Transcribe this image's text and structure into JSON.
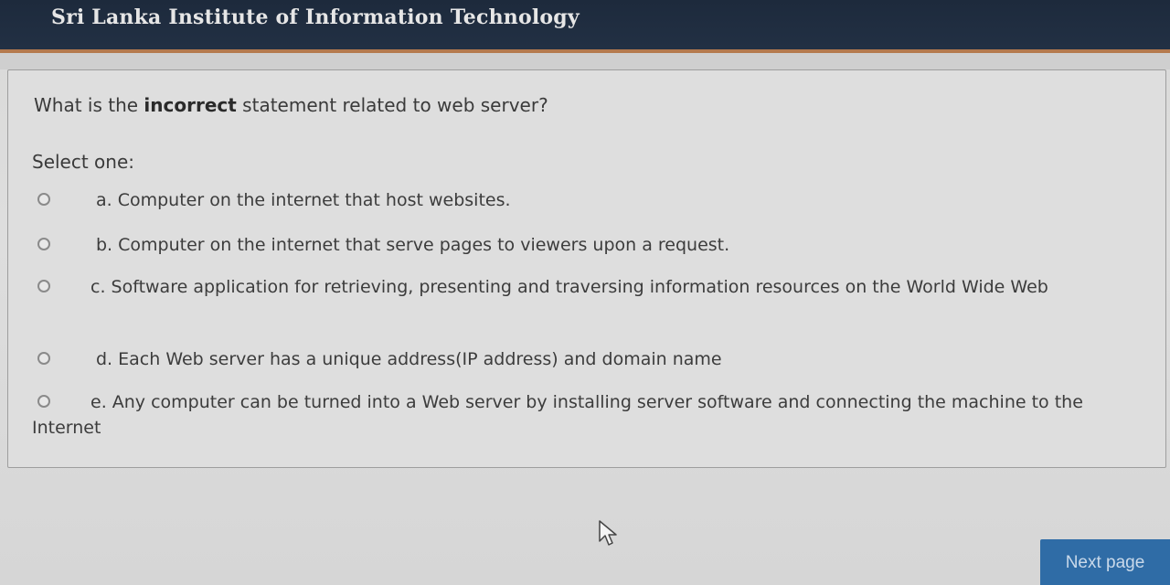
{
  "header": {
    "title": "Sri Lanka Institute of Information Technology"
  },
  "question": {
    "prefix": "What is the ",
    "emphasis": "incorrect",
    "suffix": " statement related to web server?",
    "select_label": "Select one:",
    "options": [
      {
        "label": "a. Computer on the internet that host websites."
      },
      {
        "label": "b.  Computer on the internet that serve pages to viewers upon a request."
      },
      {
        "label": "c. Software application for retrieving, presenting and traversing information resources on the World Wide Web"
      },
      {
        "label": "d. Each Web server has a unique address(IP address) and domain name"
      },
      {
        "label": "e. Any computer can be turned into a Web server by installing server software and connecting the machine to the Internet"
      }
    ]
  },
  "footer": {
    "next_label": "Next page"
  },
  "icons": {
    "cursor": "mouse-pointer-icon",
    "radio": "radio-circle-icon"
  },
  "colors": {
    "header_bg": "#1d2a3c",
    "header_accent": "#b57a4e",
    "button_bg": "#2f6ca6"
  }
}
